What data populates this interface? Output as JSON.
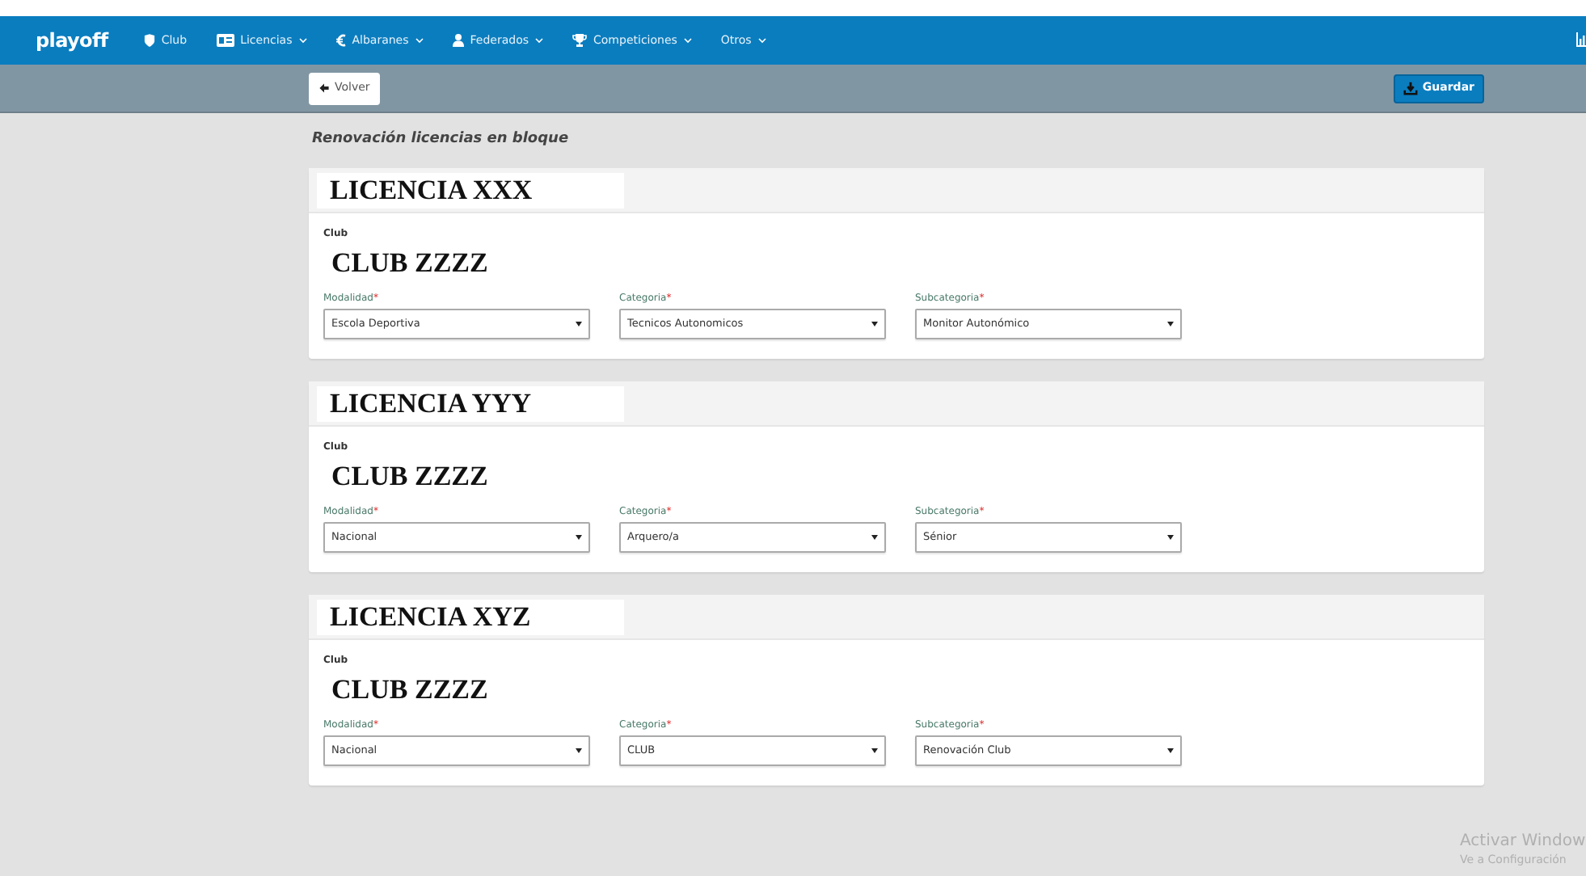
{
  "navbar": {
    "brand": "playoff",
    "items": [
      {
        "label": "Club",
        "dropdown": false
      },
      {
        "label": "Licencias",
        "dropdown": true
      },
      {
        "label": "Albaranes",
        "dropdown": true
      },
      {
        "label": "Federados",
        "dropdown": true
      },
      {
        "label": "Competiciones",
        "dropdown": true
      },
      {
        "label": "Otros",
        "dropdown": true
      }
    ]
  },
  "toolbar": {
    "back_button": "Volver",
    "save_button": "Guardar"
  },
  "page_title": "Renovación licencias en bloque",
  "licenses": [
    {
      "title": "LICENCIA XXX",
      "club_label": "Club",
      "club": "CLUB ZZZZ",
      "fields": [
        {
          "label": "Modalidad",
          "required_mark": "*",
          "value": "Escola Deportiva"
        },
        {
          "label": "Categoria",
          "required_mark": "*",
          "value": "Tecnicos Autonomicos"
        },
        {
          "label": "Subcategoria",
          "required_mark": "*",
          "value": "Monitor Autonómico"
        }
      ]
    },
    {
      "title": "LICENCIA YYY",
      "club_label": "Club",
      "club": "CLUB ZZZZ",
      "fields": [
        {
          "label": "Modalidad",
          "required_mark": "*",
          "value": "Nacional"
        },
        {
          "label": "Categoria",
          "required_mark": "*",
          "value": "Arquero/a"
        },
        {
          "label": "Subcategoria",
          "required_mark": "*",
          "value": "Sénior"
        }
      ]
    },
    {
      "title": "LICENCIA XYZ",
      "club_label": "Club",
      "club": "CLUB ZZZZ",
      "fields": [
        {
          "label": "Modalidad",
          "required_mark": "*",
          "value": "Nacional"
        },
        {
          "label": "Categoria",
          "required_mark": "*",
          "value": "CLUB"
        },
        {
          "label": "Subcategoria",
          "required_mark": "*",
          "value": "Renovación Club"
        }
      ]
    }
  ],
  "os_notice": {
    "title": "Activar Window",
    "subtitle": "Ve a Configuración"
  }
}
